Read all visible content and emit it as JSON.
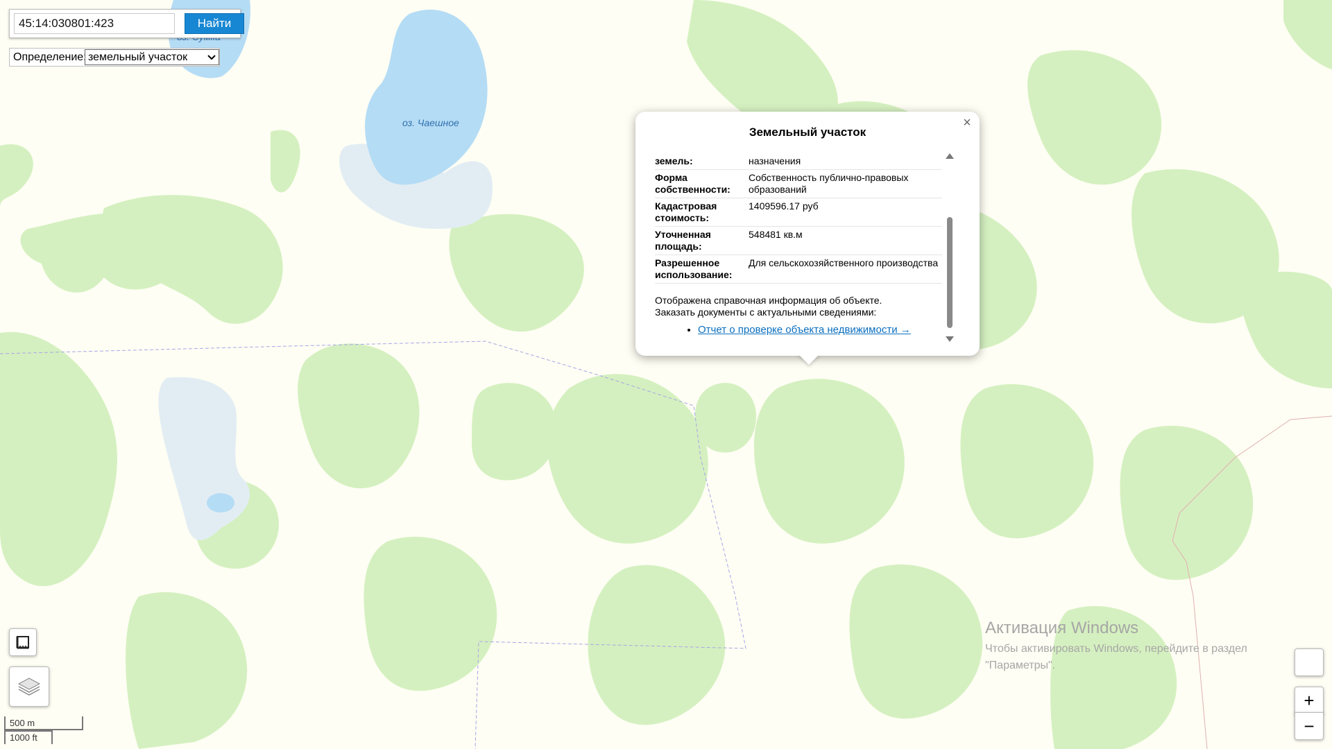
{
  "search": {
    "value": "45:14:030801:423",
    "button_label": "Найти"
  },
  "definition": {
    "label": "Определение:",
    "selected": "земельный участок"
  },
  "map_labels": {
    "lake_top": "оз. Сумка",
    "lake_main": "оз. Чаешное"
  },
  "popup": {
    "title": "Земельный участок",
    "close_symbol": "×",
    "rows": [
      {
        "key": "земель:",
        "value": "назначения"
      },
      {
        "key": "Форма собственности:",
        "value": "Собственность публично-правовых образований"
      },
      {
        "key": "Кадастровая стоимость:",
        "value": "1409596.17 руб"
      },
      {
        "key": "Уточненная площадь:",
        "value": "548481 кв.м"
      },
      {
        "key": "Разрешенное использование:",
        "value": "Для сельскохозяйственного производства"
      }
    ],
    "info_line1": "Отображена справочная информация об объекте.",
    "info_line2": "Заказать документы с актуальными сведениями:",
    "link": "Отчет о проверке объекта недвижимости →"
  },
  "scale": {
    "metric": "500 m",
    "imperial": "1000 ft"
  },
  "watermark": {
    "title": "Активация Windows",
    "line1": "Чтобы активировать Windows, перейдите в раздел",
    "line2": "\"Параметры\"."
  },
  "zoom": {
    "in": "+",
    "out": "−"
  },
  "icons": {
    "ruler": "ruler-icon",
    "layers": "layers-icon"
  },
  "colors": {
    "forest": "#d5f0c0",
    "water": "#b5dcf5",
    "wetland": "#e2edf3",
    "background": "#fefef4",
    "accent": "#1787d3"
  }
}
